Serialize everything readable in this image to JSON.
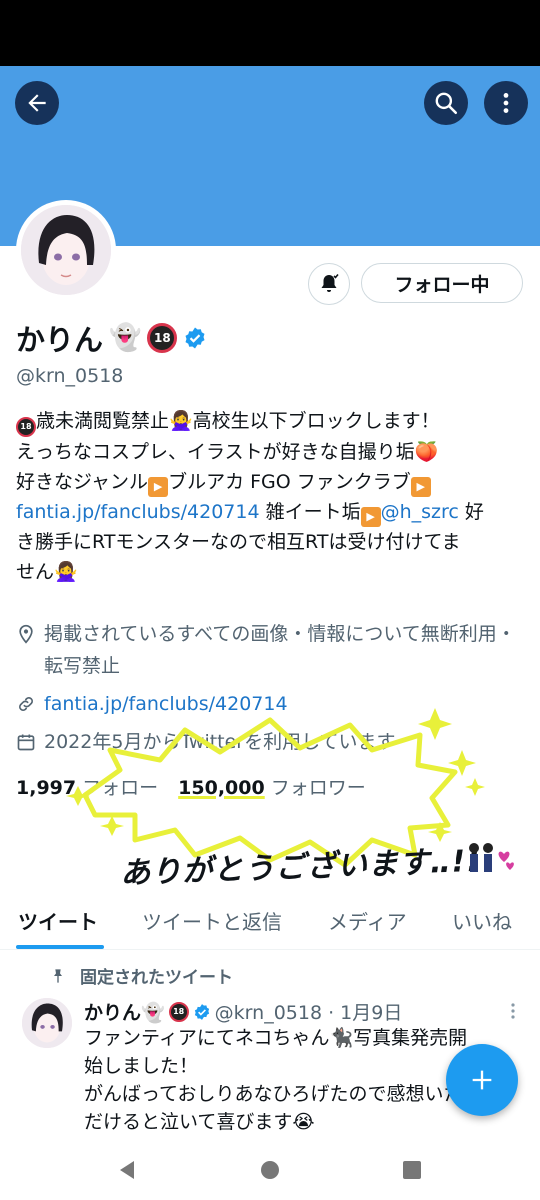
{
  "header": {
    "back_icon": "arrow-left-icon",
    "search_icon": "search-icon",
    "more_icon": "more-vertical-icon",
    "banner_color": "#4a9de6"
  },
  "profile": {
    "name": "かりん",
    "name_emoji": "👻",
    "age_badge": "18",
    "handle": "@krn_0518",
    "follow_label": "フォロー中",
    "bell_icon": "bell-notify-icon",
    "bio": {
      "line1_text": "歳未満閲覧禁止🙅‍♀️高校生以下ブロックします！",
      "line2": "えっちなコスプレ、イラストが好きな自撮り垢🍑",
      "line3_a": "好きなジャンル",
      "line3_b": "ブルアカ FGO ファンクラブ",
      "line4_link": "fantia.jp/fanclubs/420714",
      "line4_text": " 雑イート垢",
      "line4_mention": "@h_szrc",
      "line4_tail": " 好",
      "line5": "き勝手にRTモンスターなので相互RTは受け付けてま",
      "line6": "せん🙅‍♀️"
    },
    "location": "掲載されているすべての画像・情報について無断利用・転写禁止",
    "website": "fantia.jp/fanclubs/420714",
    "joined": "2022年5月からTwitterを利用しています",
    "following_count": "1,997",
    "following_label": "フォロー",
    "followers_count": "150,000",
    "followers_label": "フォロワー"
  },
  "overlay": {
    "thanks_text": "ありがとうございます‥!!",
    "accent_color": "#e8f03a"
  },
  "tabs": [
    {
      "label": "ツイート"
    },
    {
      "label": "ツイートと返信"
    },
    {
      "label": "メディア"
    },
    {
      "label": "いいね"
    }
  ],
  "pinned_tweet": {
    "pinned_label": "固定されたツイート",
    "name": "かりん👻",
    "handle_date": "@krn_0518 · 1月9日",
    "body_line1": "ファンティアにてネコちゃん🐈‍⬛写真集発売開",
    "body_line2": "始しました！",
    "body_line3": "がんばっておしりあなひろげたので感想いた",
    "body_line4": "だけると泣いて喜びます😭"
  },
  "fab_icon": "plus-icon",
  "system_nav": {
    "back_icon": "triangle-back-icon",
    "home_icon": "circle-home-icon",
    "recents_icon": "square-recents-icon"
  }
}
